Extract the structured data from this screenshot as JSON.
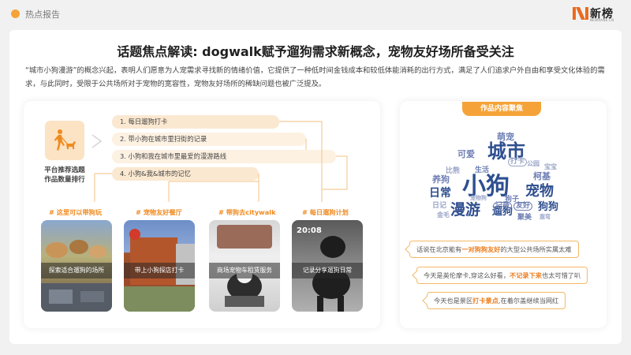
{
  "header": {
    "section_label": "热点报告",
    "brand_name": "新榜",
    "brand_sub": "NEWRANK.CN",
    "accent_color": "#f5a338"
  },
  "title": "话题焦点解读: dogwalk赋予遛狗需求新概念，宠物友好场所备受关注",
  "intro": "“城市小狗漫游”的概念兴起，表明人们愿意为人宠需求寻找新的情绪价值，它提供了一种低时间金钱成本和较低体能消耗的出行方式，满足了人们追求户外自由和享受文化体验的需求，与此同时，受限于公共场所对于宠物的宽容性，宠物友好场所的稀缺问题也被广泛提及。",
  "platform": {
    "label_line1": "平台推荐选题",
    "label_line2": "作品数量排行",
    "icon": "walking-dog-icon"
  },
  "topics": [
    "1. 每日遛狗打卡",
    "2. 带小狗在城市里扫街的记录",
    "3. 小狗和我在城市里最爱的漫游路线",
    "4. 小狗&我&城市的记忆"
  ],
  "tags": [
    "# 这里可以带狗玩",
    "# 宠物友好餐厅",
    "# 带狗去citywalk",
    "# 每日遛狗计划"
  ],
  "thumbnails": [
    {
      "caption": "探索适合遛狗的场所"
    },
    {
      "caption": "带上小狗探店打卡"
    },
    {
      "caption": "商场宠物车租赁服务"
    },
    {
      "caption": "记录分享遛狗日常",
      "time": "20:08"
    }
  ],
  "focus": {
    "label": "作品内容聚焦",
    "word_cloud": [
      {
        "text": "小狗",
        "color": "#2f4f8f"
      },
      {
        "text": "城市",
        "color": "#2f4f8f"
      },
      {
        "text": "漫游",
        "color": "#2f4f8f"
      },
      {
        "text": "宠物",
        "color": "#2f4f8f"
      },
      {
        "text": "遛狗",
        "color": "#2f4f8f"
      },
      {
        "text": "日常",
        "color": "#2f4f8f"
      },
      {
        "text": "狗狗",
        "color": "#2f4f8f"
      },
      {
        "text": "萌宠",
        "color": "#6d7eb3"
      },
      {
        "text": "可爱",
        "color": "#6d7eb3"
      },
      {
        "text": "养狗",
        "color": "#6d7eb3"
      },
      {
        "text": "生活",
        "color": "#6d7eb3"
      },
      {
        "text": "柯基",
        "color": "#6d7eb3"
      },
      {
        "text": "记录",
        "color": "#6d7eb3"
      },
      {
        "text": "友好",
        "color": "#6d7eb3"
      },
      {
        "text": "狗子",
        "color": "#6d7eb3"
      },
      {
        "text": "聚美",
        "color": "#6d7eb3"
      },
      {
        "text": "比熊",
        "color": "#9aa5c8"
      },
      {
        "text": "日记",
        "color": "#9aa5c8"
      },
      {
        "text": "金毛",
        "color": "#9aa5c8"
      },
      {
        "text": "打卡",
        "color": "#9aa5c8"
      },
      {
        "text": "宝宝",
        "color": "#9aa5c8"
      },
      {
        "text": "宠物狗",
        "color": "#9aa5c8"
      },
      {
        "text": "公园",
        "color": "#9aa5c8"
      },
      {
        "text": "遛弯",
        "color": "#9aa5c8"
      }
    ],
    "quotes": [
      {
        "pre": "话说在北京能有",
        "hl": "一对狗狗友好",
        "post": "的大型公共场所实属太难"
      },
      {
        "pre": "今天是英伦摩卡,穿这么好看，",
        "hl": "不记录下来",
        "post": "也太可惜了叭"
      },
      {
        "pre": "今天也是景区",
        "hl": "打卡景点",
        "post": ",在着尔盖继续当网红"
      }
    ]
  }
}
